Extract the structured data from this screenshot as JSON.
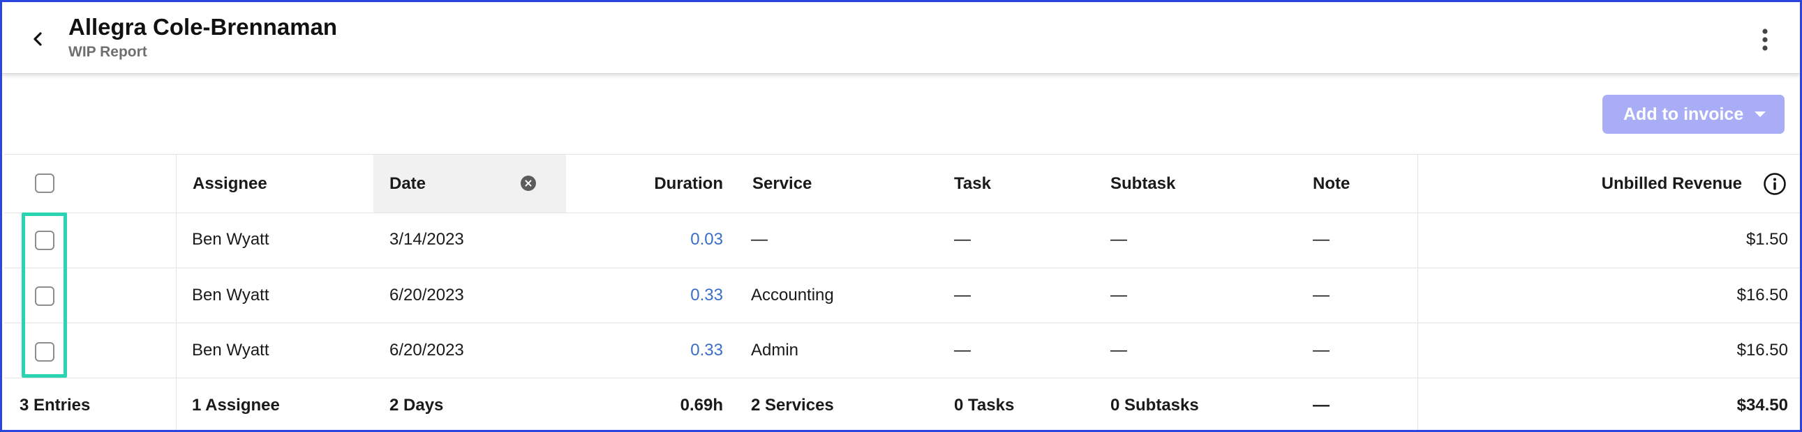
{
  "header": {
    "title": "Allegra Cole-Brennaman",
    "subtitle": "WIP Report"
  },
  "toolbar": {
    "add_to_invoice_label": "Add to invoice"
  },
  "table": {
    "columns": {
      "assignee": "Assignee",
      "date": "Date",
      "duration": "Duration",
      "service": "Service",
      "task": "Task",
      "subtask": "Subtask",
      "note": "Note",
      "unbilled_revenue": "Unbilled Revenue"
    },
    "rows": [
      {
        "assignee": "Ben Wyatt",
        "date": "3/14/2023",
        "duration": "0.03",
        "service": "—",
        "task": "—",
        "subtask": "—",
        "note": "—",
        "unbilled_revenue": "$1.50"
      },
      {
        "assignee": "Ben Wyatt",
        "date": "6/20/2023",
        "duration": "0.33",
        "service": "Accounting",
        "task": "—",
        "subtask": "—",
        "note": "—",
        "unbilled_revenue": "$16.50"
      },
      {
        "assignee": "Ben Wyatt",
        "date": "6/20/2023",
        "duration": "0.33",
        "service": "Admin",
        "task": "—",
        "subtask": "—",
        "note": "—",
        "unbilled_revenue": "$16.50"
      }
    ],
    "totals": {
      "entries": "3 Entries",
      "assignee": "1 Assignee",
      "date": "2 Days",
      "duration": "0.69h",
      "service": "2 Services",
      "task": "0 Tasks",
      "subtask": "0 Subtasks",
      "note": "—",
      "unbilled_revenue": "$34.50"
    }
  },
  "colors": {
    "frame_border": "#2b46e0",
    "accent_button": "#a9adf5",
    "link_blue": "#3a6ec7",
    "highlight": "#2ad3b2"
  },
  "icons": {
    "back": "chevron-left-icon",
    "menu": "kebab-menu-icon",
    "clear_date": "close-circle-icon",
    "info": "info-icon"
  }
}
